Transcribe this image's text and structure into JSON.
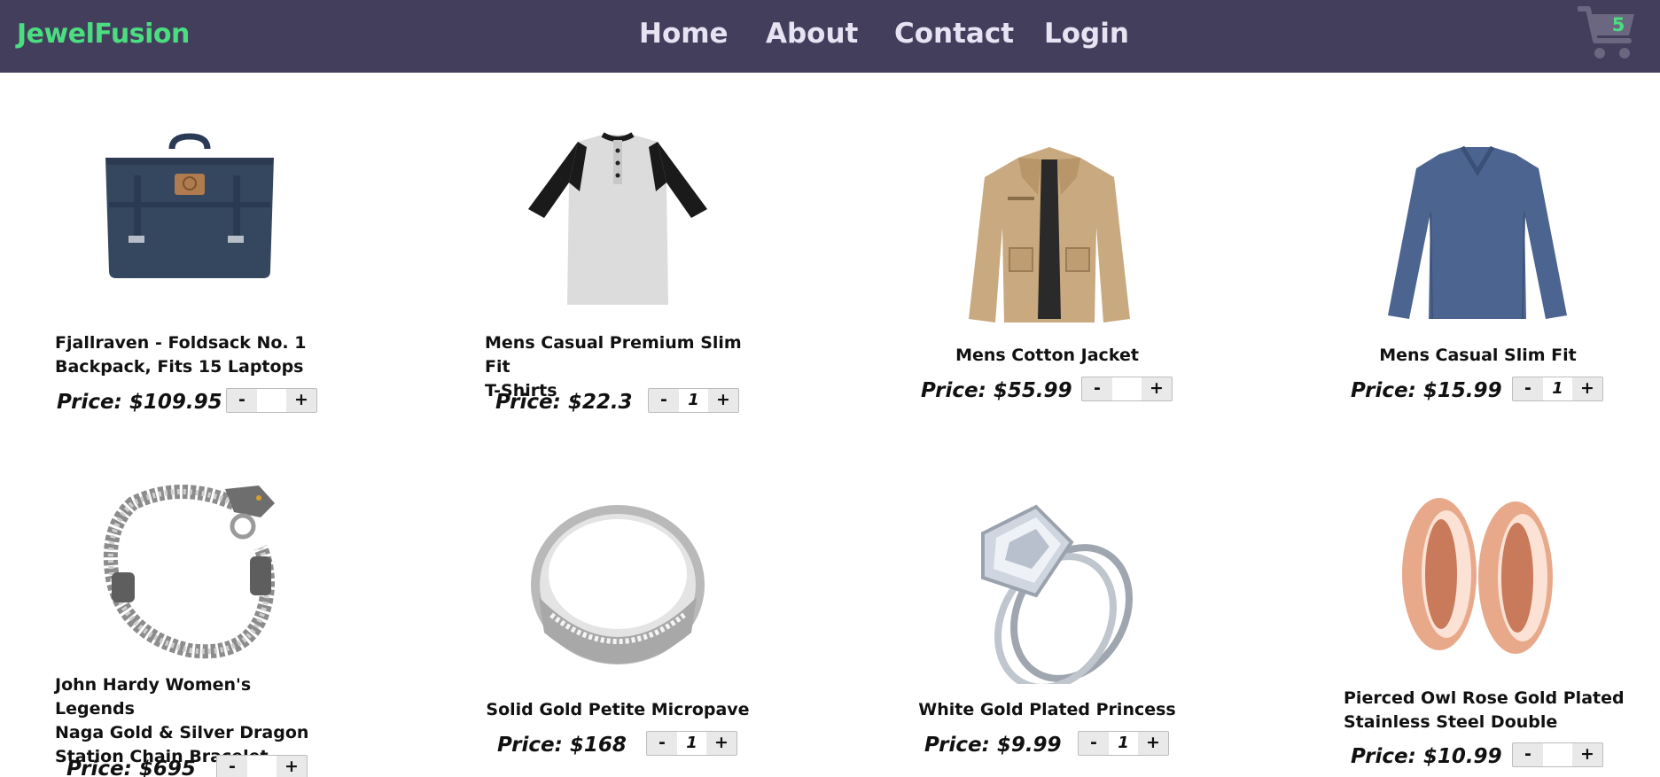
{
  "brand": "JewelFusion",
  "nav": {
    "home": "Home",
    "about": "About",
    "contact": "Contact",
    "login": "Login"
  },
  "cart": {
    "count": "5",
    "icon": "shopping-cart-icon"
  },
  "colors": {
    "navbar": "#423e5c",
    "brand": "#4ade80",
    "nav_text": "#e8e3f3",
    "cart_icon": "#6b6780"
  },
  "products": [
    {
      "name_line1": "Fjallraven - Foldsack No. 1",
      "name_line2": "Backpack, Fits 15 Laptops",
      "price": "Price: $109.95",
      "qty": "",
      "image": "navy-backpack"
    },
    {
      "name_line1": "Mens Casual Premium Slim Fit",
      "name_line2": "T-Shirts",
      "price": "Price: $22.3",
      "qty": "1",
      "image": "raglan-henley-shirt"
    },
    {
      "name_line1": "Mens Cotton Jacket",
      "price": "Price: $55.99",
      "qty": "",
      "image": "khaki-jacket"
    },
    {
      "name_line1": "Mens Casual Slim Fit",
      "price": "Price: $15.99",
      "qty": "1",
      "image": "blue-long-sleeve-shirt"
    },
    {
      "name_line1": "John Hardy Women's Legends",
      "name_line2": "Naga Gold & Silver Dragon",
      "name_line3": "Station Chain Bracelet",
      "price": "Price: $695",
      "qty": "",
      "image": "dragon-bracelet"
    },
    {
      "name_line1": "Solid Gold Petite Micropave",
      "price": "Price: $168",
      "qty": "1",
      "image": "silver-band-ring"
    },
    {
      "name_line1": "White Gold Plated Princess",
      "price": "Price: $9.99",
      "qty": "1",
      "image": "princess-cut-ring"
    },
    {
      "name_line1": "Pierced Owl Rose Gold Plated",
      "name_line2": "Stainless Steel Double",
      "price": "Price: $10.99",
      "qty": "",
      "image": "rose-gold-tunnel-plugs"
    }
  ],
  "qty_controls": {
    "minus": "-",
    "plus": "+"
  }
}
